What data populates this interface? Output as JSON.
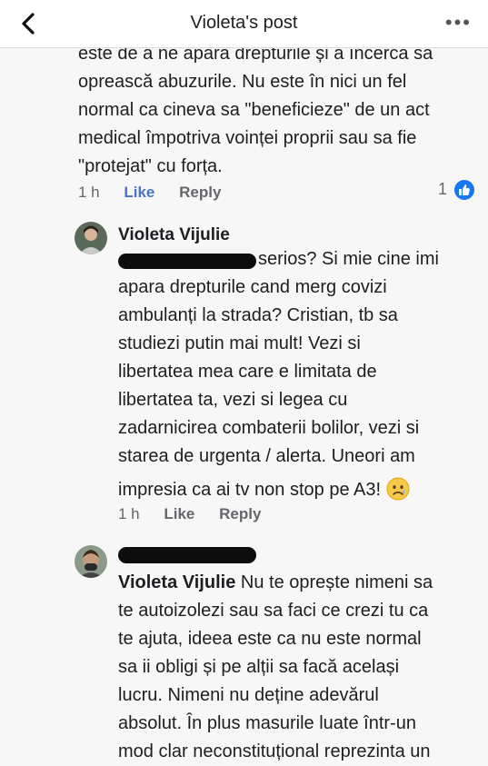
{
  "header": {
    "title": "Violeta's post"
  },
  "comment1": {
    "lines": [
      "este de a ne apara drepturile și a încerca sa",
      "oprească abuzurile. Nu este în nici un fel",
      "normal ca cineva sa \"beneficieze\" de un act",
      "medical împotriva voinței proprii sau sa fie",
      "\"protejat\" cu forța."
    ],
    "time": "1 h",
    "like_label": "Like",
    "reply_label": "Reply",
    "reaction_count": "1"
  },
  "comment2": {
    "author": "Violeta Vijulie",
    "lines": [
      "serios? Si mie cine imi",
      "apara drepturile cand merg covizi",
      "ambulanți la strada? Cristian, tb sa",
      "studiezi putin mai mult! Vezi si",
      "libertatea mea care e limitata de",
      "libertatea ta, vezi si legea cu",
      "zadarnicirea combaterii bolilor, vezi si",
      "starea de urgenta / alerta. Uneori am",
      "impresia ca ai tv non stop pe A3!"
    ],
    "time": "1 h",
    "like_label": "Like",
    "reply_label": "Reply"
  },
  "comment3": {
    "mention": "Violeta Vijulie",
    "lines": [
      "Nu te oprește nimeni sa",
      "te autoizolezi sau sa faci ce crezi tu ca",
      "te ajuta, ideea este ca nu este normal",
      "sa ii obligi și pe alții sa facă același",
      "lucru. Nimeni nu deține adevărul",
      "absolut. În plus masurile luate într-un",
      "mod clar neconstituțional reprezinta un"
    ]
  },
  "icons": {
    "back": "chevron-left-icon",
    "more": "more-dots-icon",
    "like_badge": "thumbs-up-icon",
    "emoji": "sad-face-emoji"
  },
  "colors": {
    "like_blue": "#4b74c9",
    "badge_blue": "#1877f2",
    "muted": "#65676b"
  }
}
